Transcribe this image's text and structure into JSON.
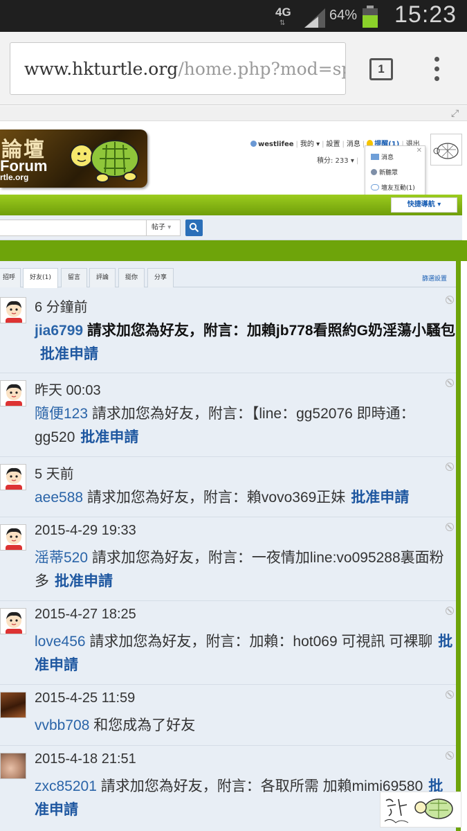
{
  "status_bar": {
    "network": "4G",
    "battery_percent": "64%",
    "battery_level": 0.64,
    "time": "15:23"
  },
  "browser": {
    "url_host": "www.hkturtle.org",
    "url_path": "/home.php?mod=sp",
    "tab_count": "1"
  },
  "site": {
    "logo_title": "論壇",
    "logo_sub": "Forum",
    "logo_domain": "rtle.org"
  },
  "userbar": {
    "username": "westlifee",
    "my": "我的",
    "settings": "設置",
    "messages": "消息",
    "remind": "提醒(1)",
    "logout": "退出",
    "points": "積分: 233"
  },
  "notify_popup": {
    "items": [
      {
        "label": "消息"
      },
      {
        "label": "新聽眾"
      },
      {
        "label": "壇友互動(1)"
      }
    ]
  },
  "nav": {
    "quick_nav": "快捷導航",
    "search_type": "帖子"
  },
  "tabs": [
    {
      "label": "招呼"
    },
    {
      "label": "好友(1)"
    },
    {
      "label": "留言"
    },
    {
      "label": "評論"
    },
    {
      "label": "挺你"
    },
    {
      "label": "分享"
    }
  ],
  "filter_label": "篩選設置",
  "approve_label": "批准申請",
  "entries": [
    {
      "time": "6 分鐘前",
      "user": "jia6799",
      "text": " 請求加您為好友，附言：加賴jb778看照約G奶淫蕩小騷包",
      "approve": "批准申請"
    },
    {
      "time": "昨天 00:03",
      "user": "隨便123",
      "text": " 請求加您為好友，附言：【line：gg52076 即時通：gg520",
      "approve": "批准申請"
    },
    {
      "time": "5 天前",
      "user": "aee588",
      "text": " 請求加您為好友，附言：賴vovo369正妹",
      "approve": "批准申請"
    },
    {
      "time": "2015-4-29 19:33",
      "user": "滛蒂520",
      "text": " 請求加您為好友，附言：一夜情加line:vo095288裏面粉多",
      "approve": "批准申請"
    },
    {
      "time": "2015-4-27 18:25",
      "user": "love456",
      "text": " 請求加您為好友，附言：加賴：hot069 可視訊 可裸聊",
      "approve": "批准申請"
    },
    {
      "time": "2015-4-25 11:59",
      "user": "vvbb708",
      "text": " 和您成為了好友",
      "approve": ""
    },
    {
      "time": "2015-4-18 21:51",
      "user": "zxc85201",
      "text": " 請求加您為好友，附言：各取所需 加賴mimi69580",
      "approve": "批准申請"
    }
  ],
  "colors": {
    "accent_green": "#6ea40a",
    "link_blue": "#2a64a8",
    "panel_bg": "#e8eef5"
  }
}
